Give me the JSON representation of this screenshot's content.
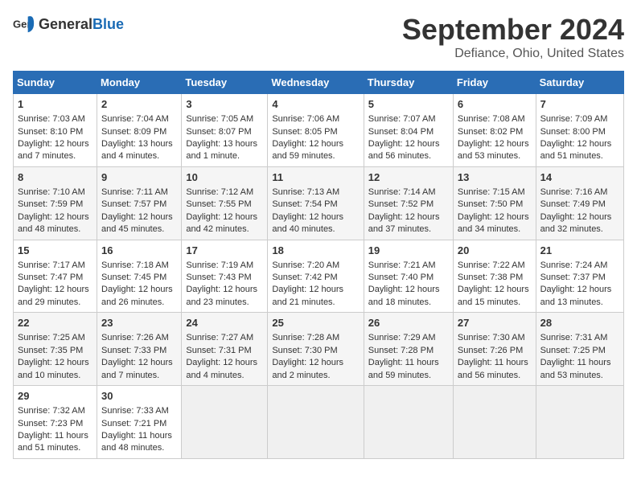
{
  "logo": {
    "general": "General",
    "blue": "Blue"
  },
  "title": "September 2024",
  "subtitle": "Defiance, Ohio, United States",
  "days_of_week": [
    "Sunday",
    "Monday",
    "Tuesday",
    "Wednesday",
    "Thursday",
    "Friday",
    "Saturday"
  ],
  "weeks": [
    [
      {
        "day": 1,
        "sunrise": "7:03 AM",
        "sunset": "8:10 PM",
        "daylight": "12 hours and 7 minutes."
      },
      {
        "day": 2,
        "sunrise": "7:04 AM",
        "sunset": "8:09 PM",
        "daylight": "13 hours and 4 minutes."
      },
      {
        "day": 3,
        "sunrise": "7:05 AM",
        "sunset": "8:07 PM",
        "daylight": "13 hours and 1 minute."
      },
      {
        "day": 4,
        "sunrise": "7:06 AM",
        "sunset": "8:05 PM",
        "daylight": "12 hours and 59 minutes."
      },
      {
        "day": 5,
        "sunrise": "7:07 AM",
        "sunset": "8:04 PM",
        "daylight": "12 hours and 56 minutes."
      },
      {
        "day": 6,
        "sunrise": "7:08 AM",
        "sunset": "8:02 PM",
        "daylight": "12 hours and 53 minutes."
      },
      {
        "day": 7,
        "sunrise": "7:09 AM",
        "sunset": "8:00 PM",
        "daylight": "12 hours and 51 minutes."
      }
    ],
    [
      {
        "day": 8,
        "sunrise": "7:10 AM",
        "sunset": "7:59 PM",
        "daylight": "12 hours and 48 minutes."
      },
      {
        "day": 9,
        "sunrise": "7:11 AM",
        "sunset": "7:57 PM",
        "daylight": "12 hours and 45 minutes."
      },
      {
        "day": 10,
        "sunrise": "7:12 AM",
        "sunset": "7:55 PM",
        "daylight": "12 hours and 42 minutes."
      },
      {
        "day": 11,
        "sunrise": "7:13 AM",
        "sunset": "7:54 PM",
        "daylight": "12 hours and 40 minutes."
      },
      {
        "day": 12,
        "sunrise": "7:14 AM",
        "sunset": "7:52 PM",
        "daylight": "12 hours and 37 minutes."
      },
      {
        "day": 13,
        "sunrise": "7:15 AM",
        "sunset": "7:50 PM",
        "daylight": "12 hours and 34 minutes."
      },
      {
        "day": 14,
        "sunrise": "7:16 AM",
        "sunset": "7:49 PM",
        "daylight": "12 hours and 32 minutes."
      }
    ],
    [
      {
        "day": 15,
        "sunrise": "7:17 AM",
        "sunset": "7:47 PM",
        "daylight": "12 hours and 29 minutes."
      },
      {
        "day": 16,
        "sunrise": "7:18 AM",
        "sunset": "7:45 PM",
        "daylight": "12 hours and 26 minutes."
      },
      {
        "day": 17,
        "sunrise": "7:19 AM",
        "sunset": "7:43 PM",
        "daylight": "12 hours and 23 minutes."
      },
      {
        "day": 18,
        "sunrise": "7:20 AM",
        "sunset": "7:42 PM",
        "daylight": "12 hours and 21 minutes."
      },
      {
        "day": 19,
        "sunrise": "7:21 AM",
        "sunset": "7:40 PM",
        "daylight": "12 hours and 18 minutes."
      },
      {
        "day": 20,
        "sunrise": "7:22 AM",
        "sunset": "7:38 PM",
        "daylight": "12 hours and 15 minutes."
      },
      {
        "day": 21,
        "sunrise": "7:24 AM",
        "sunset": "7:37 PM",
        "daylight": "12 hours and 13 minutes."
      }
    ],
    [
      {
        "day": 22,
        "sunrise": "7:25 AM",
        "sunset": "7:35 PM",
        "daylight": "12 hours and 10 minutes."
      },
      {
        "day": 23,
        "sunrise": "7:26 AM",
        "sunset": "7:33 PM",
        "daylight": "12 hours and 7 minutes."
      },
      {
        "day": 24,
        "sunrise": "7:27 AM",
        "sunset": "7:31 PM",
        "daylight": "12 hours and 4 minutes."
      },
      {
        "day": 25,
        "sunrise": "7:28 AM",
        "sunset": "7:30 PM",
        "daylight": "12 hours and 2 minutes."
      },
      {
        "day": 26,
        "sunrise": "7:29 AM",
        "sunset": "7:28 PM",
        "daylight": "11 hours and 59 minutes."
      },
      {
        "day": 27,
        "sunrise": "7:30 AM",
        "sunset": "7:26 PM",
        "daylight": "11 hours and 56 minutes."
      },
      {
        "day": 28,
        "sunrise": "7:31 AM",
        "sunset": "7:25 PM",
        "daylight": "11 hours and 53 minutes."
      }
    ],
    [
      {
        "day": 29,
        "sunrise": "7:32 AM",
        "sunset": "7:23 PM",
        "daylight": "11 hours and 51 minutes."
      },
      {
        "day": 30,
        "sunrise": "7:33 AM",
        "sunset": "7:21 PM",
        "daylight": "11 hours and 48 minutes."
      },
      null,
      null,
      null,
      null,
      null
    ]
  ],
  "label_sunrise": "Sunrise:",
  "label_sunset": "Sunset:",
  "label_daylight": "Daylight:"
}
